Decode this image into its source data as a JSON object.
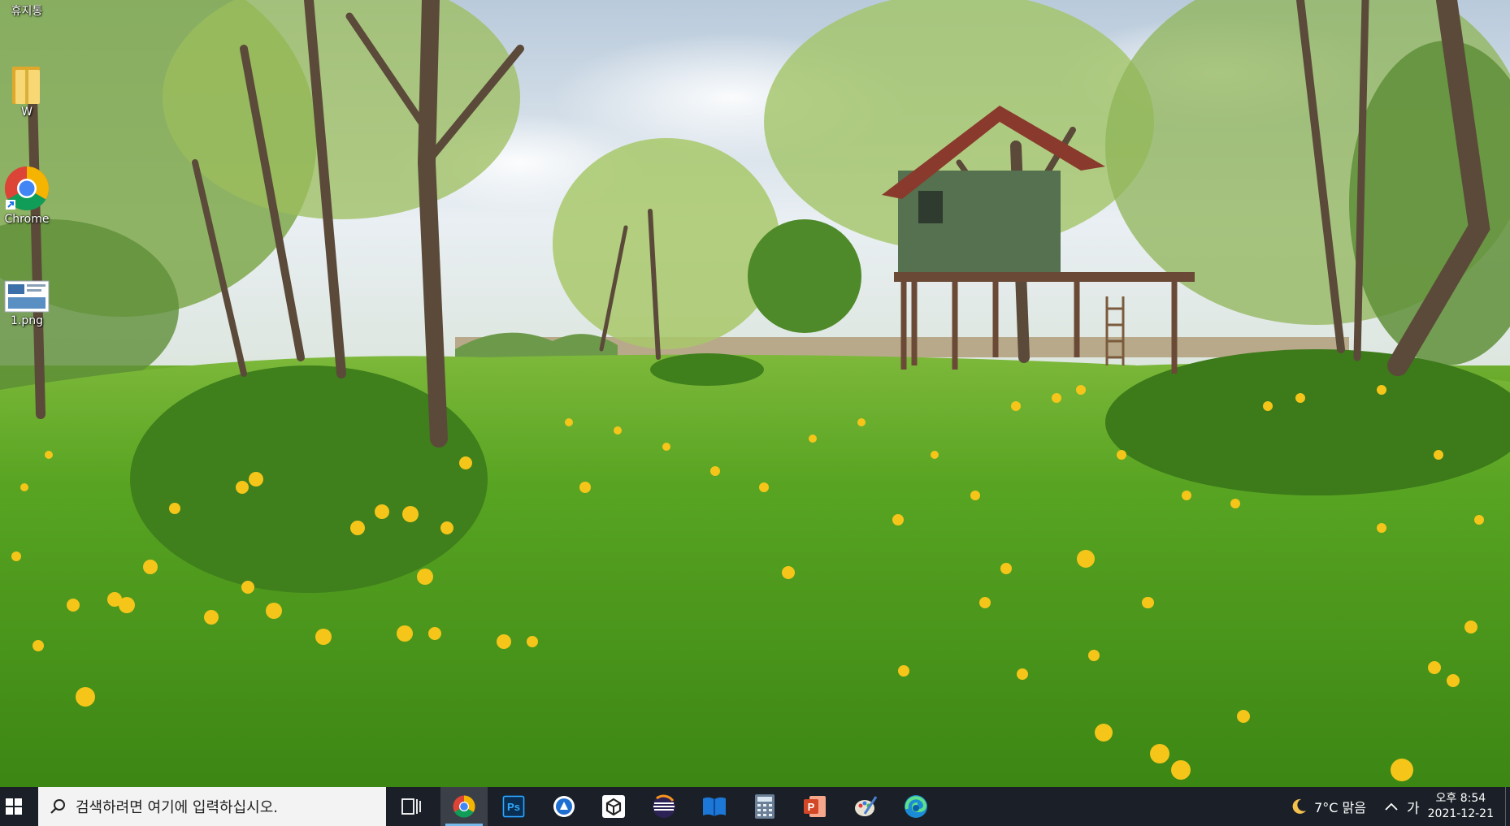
{
  "desktop": {
    "icons": [
      {
        "label": "휴지통",
        "icon": "recycle-bin-icon"
      },
      {
        "label": "W",
        "icon": "folder-icon"
      },
      {
        "label": "Chrome",
        "icon": "chrome-icon"
      },
      {
        "label": "1.png",
        "icon": "image-file-icon"
      }
    ]
  },
  "taskbar": {
    "search_placeholder": "검색하려면 여기에 입력하십시오.",
    "apps": [
      {
        "name": "Task View",
        "icon": "task-view-icon"
      },
      {
        "name": "Google Chrome",
        "icon": "chrome-icon",
        "active": true
      },
      {
        "name": "Photoshop",
        "icon": "photoshop-icon",
        "label": "Ps"
      },
      {
        "name": "App",
        "icon": "blue-app-icon"
      },
      {
        "name": "Unity",
        "icon": "unity-icon"
      },
      {
        "name": "Eclipse",
        "icon": "eclipse-icon"
      },
      {
        "name": "Reader",
        "icon": "book-icon"
      },
      {
        "name": "Calculator",
        "icon": "calculator-icon"
      },
      {
        "name": "PowerPoint",
        "icon": "powerpoint-icon",
        "label": "P"
      },
      {
        "name": "Paint",
        "icon": "paint-icon"
      },
      {
        "name": "Edge",
        "icon": "edge-icon"
      }
    ],
    "tray": {
      "weather": "7°C  맑음",
      "weather_icon": "moon-icon",
      "chevron": "^",
      "ime": "가",
      "time": "오후 8:54",
      "date": "2021-12-21"
    }
  },
  "colors": {
    "taskbar_bg": "#1b2028",
    "active_underline": "#77b7ea",
    "search_bg": "#f3f3f3"
  }
}
